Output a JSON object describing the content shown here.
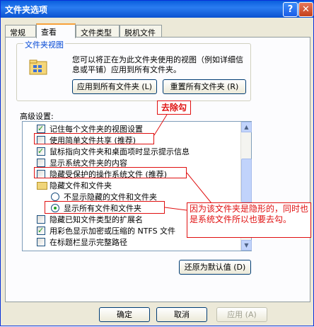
{
  "window": {
    "title": "文件夹选项",
    "help_button": "?",
    "close_button": "✕"
  },
  "tabs": [
    {
      "label": "常规"
    },
    {
      "label": "查看"
    },
    {
      "label": "文件类型"
    },
    {
      "label": "脱机文件"
    }
  ],
  "folder_views": {
    "title": "文件夹视图",
    "description": "您可以将正在为此文件夹使用的视图（例如详细信息或平铺）应用到所有文件夹。",
    "apply_all_button": "应用到所有文件夹 (L)",
    "reset_all_button": "重置所有文件夹 (R)"
  },
  "advanced": {
    "label": "高级设置:",
    "items": [
      {
        "label": "记住每个文件夹的视图设置",
        "type": "checkbox",
        "checked": true
      },
      {
        "label": "使用简单文件共享 (推荐)",
        "type": "checkbox",
        "checked": false
      },
      {
        "label": "鼠标指向文件夹和桌面项时显示提示信息",
        "type": "checkbox",
        "checked": true
      },
      {
        "label": "显示系统文件夹的内容",
        "type": "checkbox",
        "checked": false
      },
      {
        "label": "隐藏受保护的操作系统文件 (推荐)",
        "type": "checkbox",
        "checked": false
      },
      {
        "label": "隐藏文件和文件夹",
        "type": "folder",
        "checked": false
      },
      {
        "label": "不显示隐藏的文件和文件夹",
        "type": "radio",
        "checked": false
      },
      {
        "label": "显示所有文件和文件夹",
        "type": "radio",
        "checked": true
      },
      {
        "label": "隐藏已知文件类型的扩展名",
        "type": "checkbox",
        "checked": false
      },
      {
        "label": "用彩色显示加密或压缩的 NTFS 文件",
        "type": "checkbox",
        "checked": true
      },
      {
        "label": "在标题栏显示完整路径",
        "type": "checkbox",
        "checked": false
      }
    ],
    "restore_defaults_button": "还原为默认值 (D)"
  },
  "annotations": {
    "remove_check": "去除勾",
    "explanation": "因为该文件夹是隐形的，同时也是系统文件所以也要去勾。"
  },
  "footer": {
    "ok": "确定",
    "cancel": "取消",
    "apply": "应用 (A)"
  },
  "colors": {
    "title_bar": "#0a5fdd",
    "annotation_red": "#e01010",
    "check_green": "#21a121"
  }
}
